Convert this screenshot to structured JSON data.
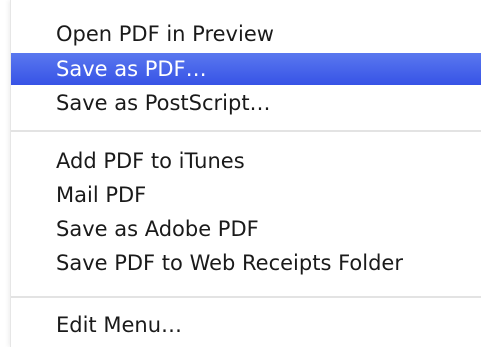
{
  "menu": {
    "items": [
      {
        "label": "Open PDF in Preview"
      },
      {
        "label": "Save as PDF…",
        "highlighted": true
      },
      {
        "label": "Save as PostScript…"
      },
      {
        "label": "Add PDF to iTunes"
      },
      {
        "label": "Mail PDF"
      },
      {
        "label": "Save as Adobe PDF"
      },
      {
        "label": "Save PDF to Web Receipts Folder"
      },
      {
        "label": "Edit Menu…"
      }
    ],
    "highlight_color": "#3e5bea"
  }
}
